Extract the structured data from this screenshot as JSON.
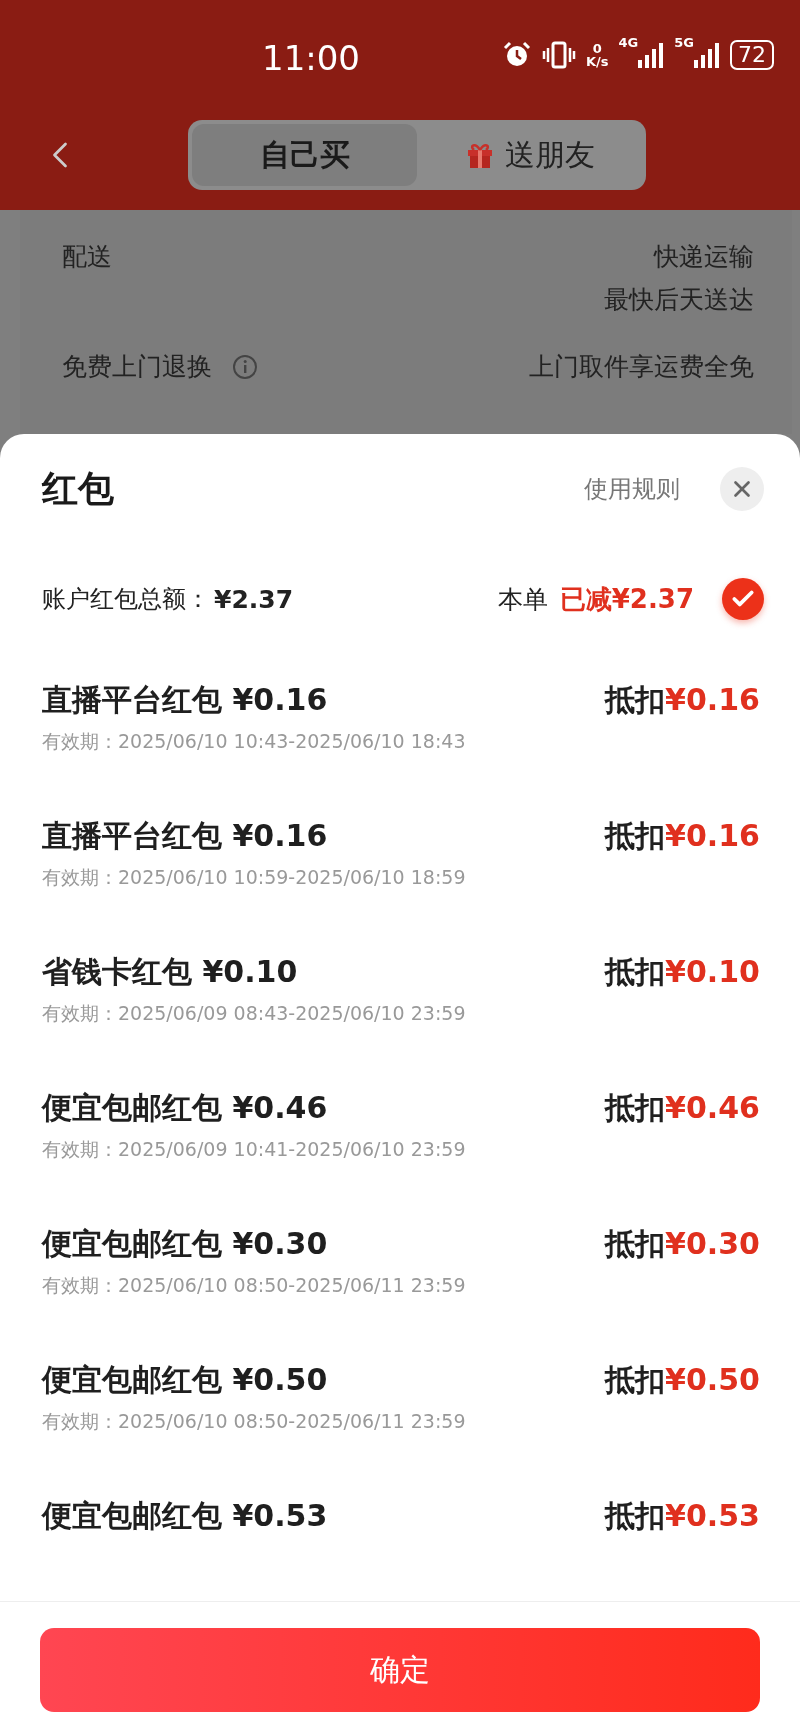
{
  "status_bar": {
    "time": "11:00",
    "net_speed": "0",
    "net_unit": "K/s",
    "network_1": "4G",
    "network_2": "5G",
    "battery": "72"
  },
  "nav": {
    "tabs": [
      {
        "label": "自己买",
        "selected": true,
        "kind": "plain"
      },
      {
        "label": "送朋友",
        "selected": false,
        "kind": "gift"
      }
    ]
  },
  "order_details": [
    {
      "label": "配送",
      "lines": [
        "快递运输",
        "最快后天送达"
      ],
      "info": false
    },
    {
      "label": "免费上门退换",
      "lines": [
        "上门取件享运费全免"
      ],
      "info": true
    }
  ],
  "sheet": {
    "title": "红包",
    "rules_link": "使用规则",
    "summary": {
      "label": "账户红包总额：",
      "total": "¥2.37",
      "order_label": "本单",
      "deducted": "已减¥2.37",
      "checked": true
    },
    "items": [
      {
        "name": "直播平台红包",
        "amount": "¥0.16",
        "validity_label": "有效期：",
        "validity": "2025/06/10 10:43-2025/06/10 18:43",
        "deduct_label": "抵扣",
        "deduct": "¥0.16"
      },
      {
        "name": "直播平台红包",
        "amount": "¥0.16",
        "validity_label": "有效期：",
        "validity": "2025/06/10 10:59-2025/06/10 18:59",
        "deduct_label": "抵扣",
        "deduct": "¥0.16"
      },
      {
        "name": "省钱卡红包",
        "amount": "¥0.10",
        "validity_label": "有效期：",
        "validity": "2025/06/09 08:43-2025/06/10 23:59",
        "deduct_label": "抵扣",
        "deduct": "¥0.10"
      },
      {
        "name": "便宜包邮红包",
        "amount": "¥0.46",
        "validity_label": "有效期：",
        "validity": "2025/06/09 10:41-2025/06/10 23:59",
        "deduct_label": "抵扣",
        "deduct": "¥0.46"
      },
      {
        "name": "便宜包邮红包",
        "amount": "¥0.30",
        "validity_label": "有效期：",
        "validity": "2025/06/10 08:50-2025/06/11 23:59",
        "deduct_label": "抵扣",
        "deduct": "¥0.30"
      },
      {
        "name": "便宜包邮红包",
        "amount": "¥0.50",
        "validity_label": "有效期：",
        "validity": "2025/06/10 08:50-2025/06/11 23:59",
        "deduct_label": "抵扣",
        "deduct": "¥0.50"
      },
      {
        "name": "便宜包邮红包",
        "amount": "¥0.53",
        "deduct_label": "抵扣",
        "deduct": "¥0.53"
      }
    ],
    "confirm_button": "确定"
  }
}
